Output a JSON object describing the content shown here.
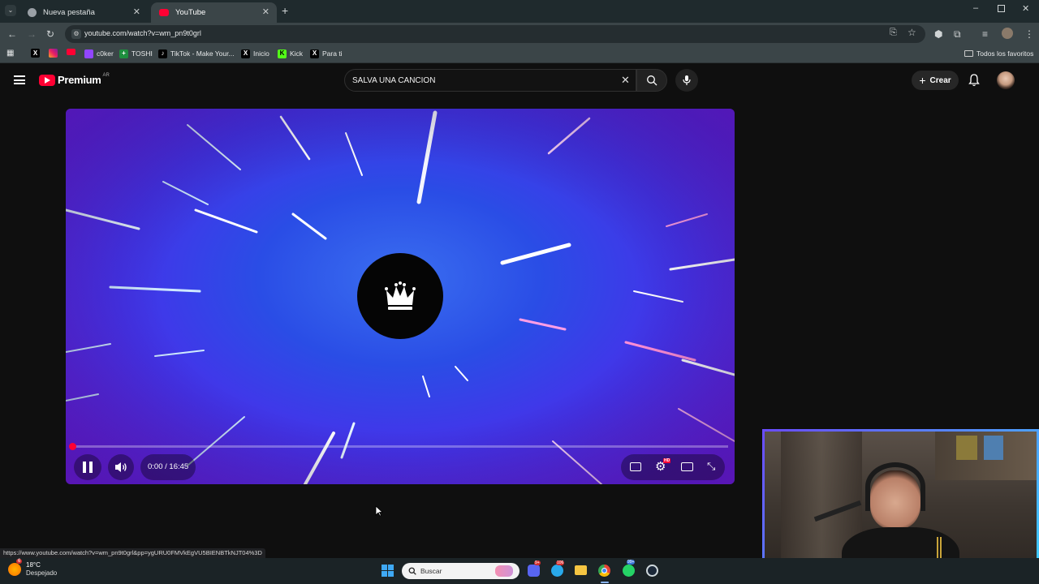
{
  "tabs": [
    {
      "label": "Nueva pestaña",
      "icon": "chrome-icon"
    },
    {
      "label": "YouTube",
      "icon": "youtube-icon"
    }
  ],
  "address": {
    "url": "youtube.com/watch?v=wm_pn9t0grl"
  },
  "bookmarks": [
    {
      "label": "",
      "icon": "x-icon"
    },
    {
      "label": "",
      "icon": "instagram-icon"
    },
    {
      "label": "",
      "icon": "youtube-icon"
    },
    {
      "label": "c0ker",
      "icon": "twitch-icon"
    },
    {
      "label": "TOSHI",
      "icon": "sheets-icon"
    },
    {
      "label": "TikTok - Make Your...",
      "icon": "tiktok-icon"
    },
    {
      "label": "Inicio",
      "icon": "x-icon"
    },
    {
      "label": "Kick",
      "icon": "kick-icon"
    },
    {
      "label": "Para ti",
      "icon": "x-icon"
    }
  ],
  "bookmarks_folder": "Todos los favoritos",
  "yt": {
    "logo_text": "Premium",
    "region": "AR",
    "search_value": "SALVA UNA CANCION",
    "create_label": "Crear"
  },
  "player": {
    "time": "0:00 / 16:45",
    "progress": 0.0,
    "settings_badge": "HD"
  },
  "status_url": "https://www.youtube.com/watch?v=wm_pn9t0grl&pp=ygURU0FMVkEgVU5BIENBTkNJT04%3D",
  "taskbar": {
    "weather_temp": "18°C",
    "weather_desc": "Despejado",
    "weather_badge": "6",
    "search_placeholder": "Buscar",
    "telegram_badge": "106",
    "whatsapp_badge": "99+",
    "discord_badge": "9+"
  },
  "colors": {
    "accent": "#ff0033",
    "player_blue": "#2a4de6",
    "player_purple": "#7b1be2"
  }
}
